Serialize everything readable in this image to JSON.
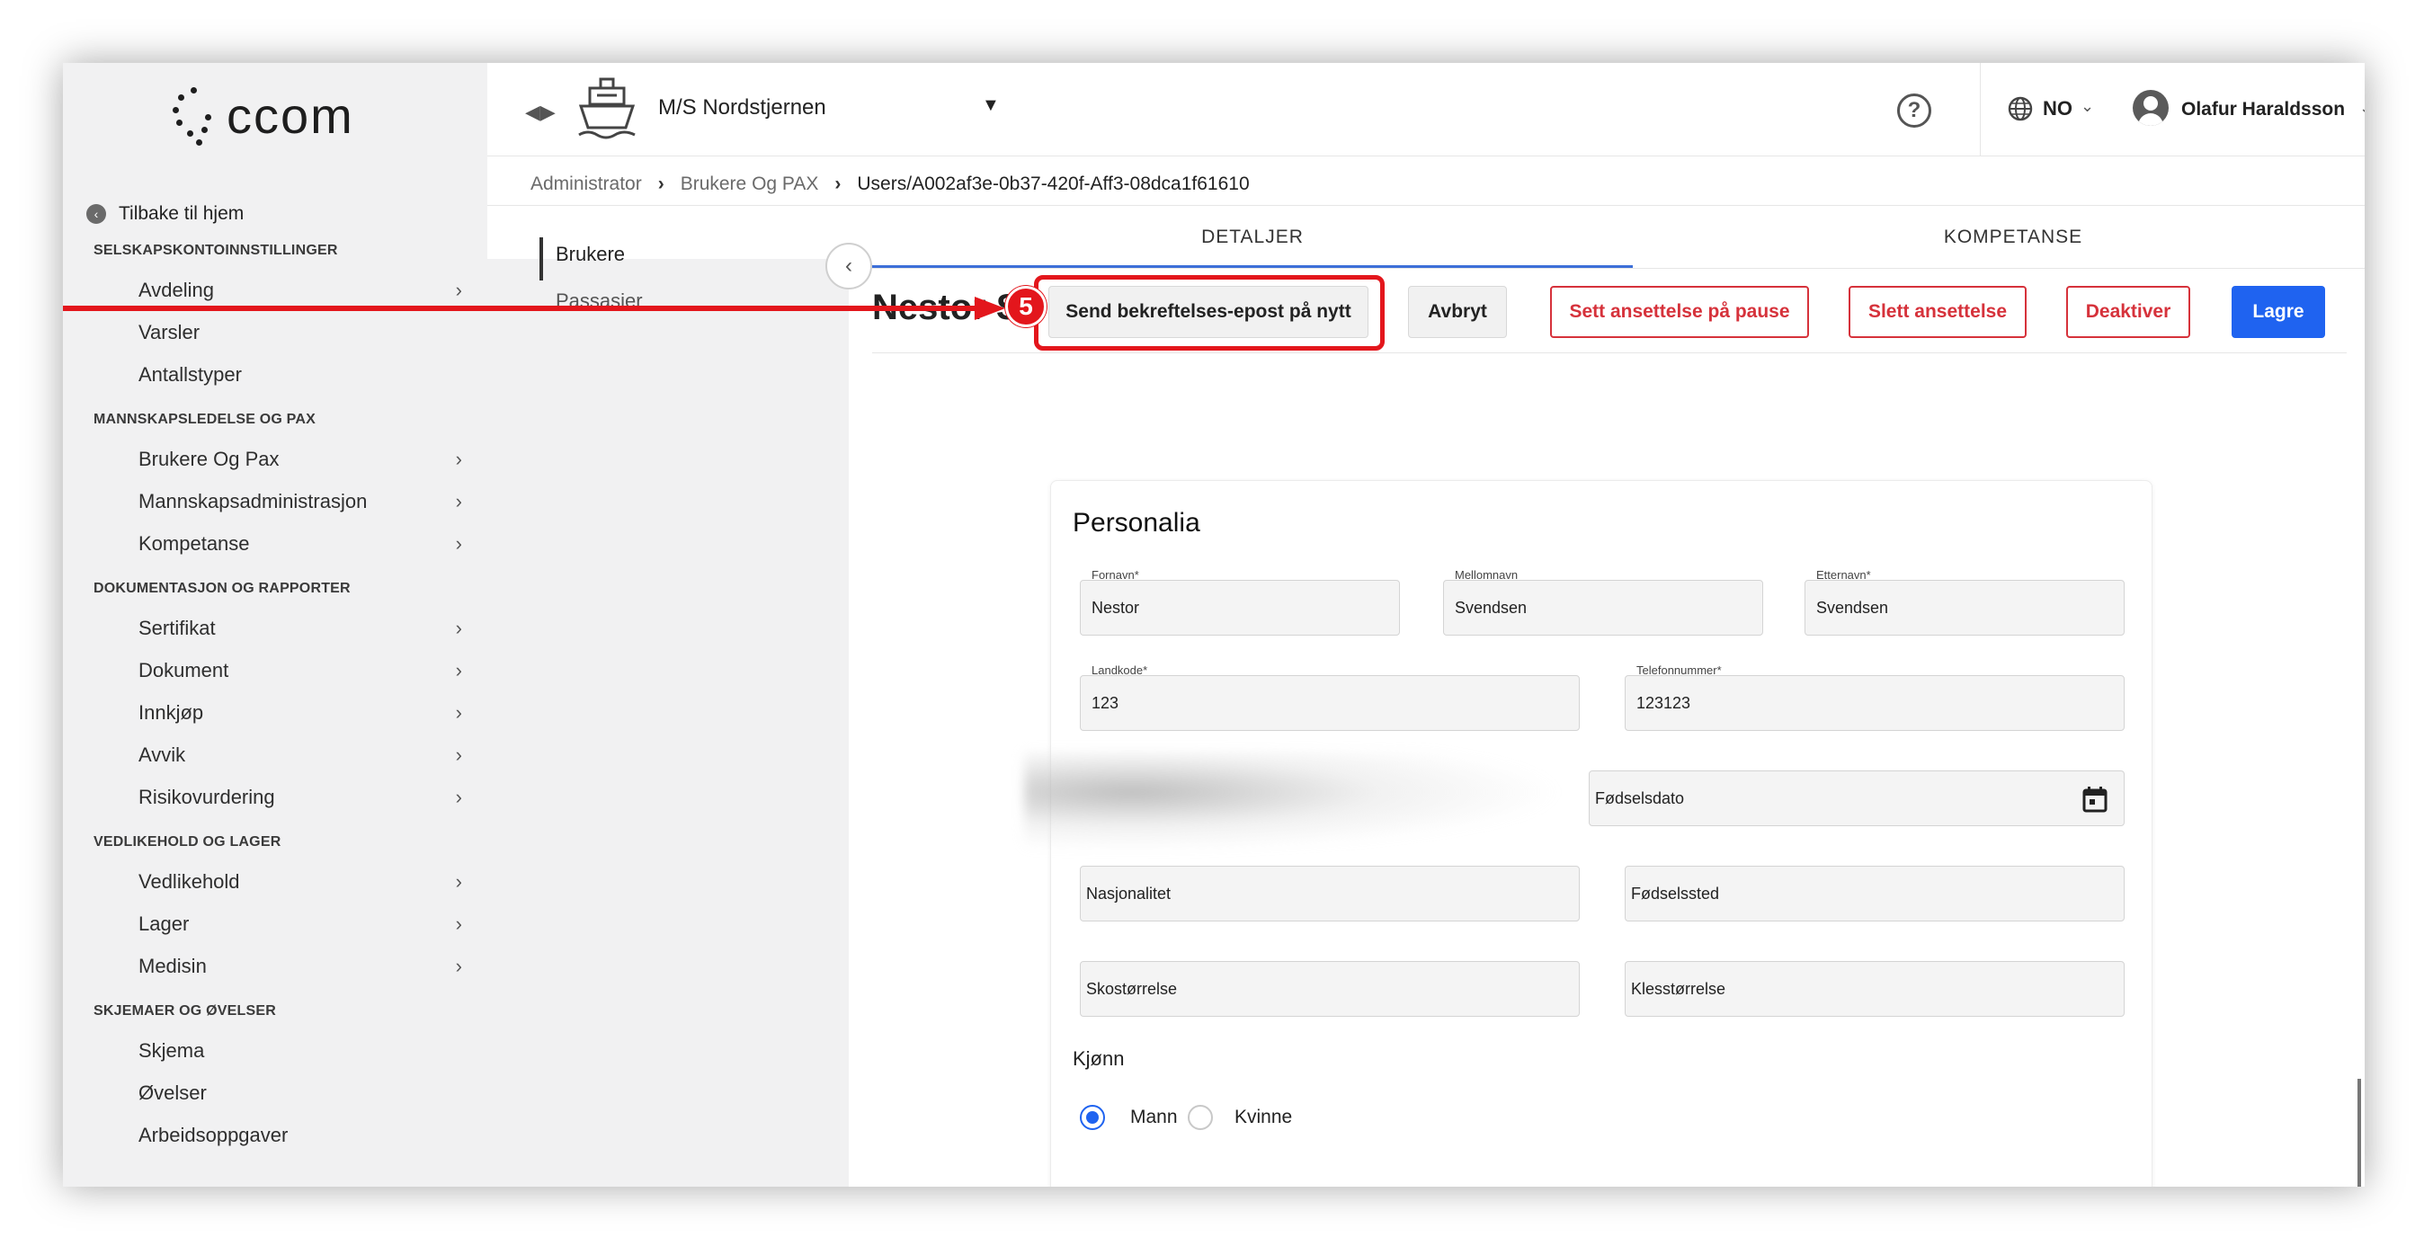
{
  "logo": {
    "text": "ccom"
  },
  "sidebar": {
    "back_label": "Tilbake til hjem",
    "sections": [
      {
        "title": "SELSKAPSKONTOINNSTILLINGER",
        "items": [
          {
            "label": "Avdeling",
            "chevron": true
          },
          {
            "label": "Varsler",
            "chevron": false
          },
          {
            "label": "Antallstyper",
            "chevron": false
          }
        ]
      },
      {
        "title": "MANNSKAPSLEDELSE OG PAX",
        "items": [
          {
            "label": "Brukere Og Pax",
            "chevron": true
          },
          {
            "label": "Mannskapsadministrasjon",
            "chevron": true
          },
          {
            "label": "Kompetanse",
            "chevron": true
          }
        ]
      },
      {
        "title": "DOKUMENTASJON OG RAPPORTER",
        "items": [
          {
            "label": "Sertifikat",
            "chevron": true
          },
          {
            "label": "Dokument",
            "chevron": true
          },
          {
            "label": "Innkjøp",
            "chevron": true
          },
          {
            "label": "Avvik",
            "chevron": true
          },
          {
            "label": "Risikovurdering",
            "chevron": true
          }
        ]
      },
      {
        "title": "VEDLIKEHOLD OG LAGER",
        "items": [
          {
            "label": "Vedlikehold",
            "chevron": true
          },
          {
            "label": "Lager",
            "chevron": true
          },
          {
            "label": "Medisin",
            "chevron": true
          }
        ]
      },
      {
        "title": "SKJEMAER OG ØVELSER",
        "items": [
          {
            "label": "Skjema",
            "chevron": false
          },
          {
            "label": "Øvelser",
            "chevron": false
          },
          {
            "label": "Arbeidsoppgaver",
            "chevron": false
          }
        ]
      }
    ]
  },
  "header": {
    "vessel_name": "M/S Nordstjernen",
    "language": "NO",
    "user_name": "Olafur Haraldsson"
  },
  "breadcrumb": {
    "items": [
      "Administrator",
      "Brukere Og PAX"
    ],
    "current": "Users/A002af3e-0b37-420f-Aff3-08dca1f61610"
  },
  "subnav": {
    "items": [
      "Brukere",
      "Passasjer"
    ]
  },
  "tabs": {
    "details": "DETALJER",
    "competence": "KOMPETANSE"
  },
  "page": {
    "title": "Nestor Svendsen"
  },
  "actions": {
    "resend": "Send bekreftelses-epost på nytt",
    "cancel": "Avbryt",
    "pause": "Sett ansettelse på pause",
    "delete": "Slett ansettelse",
    "deactivate": "Deaktiver",
    "save": "Lagre"
  },
  "annotation": {
    "step": "5",
    "color": "#e3161c"
  },
  "form": {
    "title": "Personalia",
    "first_name": {
      "label": "Fornavn*",
      "value": "Nestor"
    },
    "middle_name": {
      "label": "Mellomnavn",
      "value": "Svendsen"
    },
    "last_name": {
      "label": "Etternavn*",
      "value": "Svendsen"
    },
    "country_code": {
      "label": "Landkode*",
      "value": "123"
    },
    "phone": {
      "label": "Telefonnummer*",
      "value": "123123"
    },
    "birth_date": {
      "placeholder": "Fødselsdato"
    },
    "nationality": {
      "placeholder": "Nasjonalitet"
    },
    "birth_place": {
      "placeholder": "Fødselssted"
    },
    "shoe_size": {
      "placeholder": "Skostørrelse"
    },
    "clothing_size": {
      "placeholder": "Klesstørrelse"
    },
    "gender": {
      "label": "Kjønn",
      "options": [
        "Mann",
        "Kvinne"
      ],
      "selected": "Mann"
    }
  },
  "colors": {
    "primary": "#1f63f0",
    "danger": "#d6323b",
    "tab_underline": "#3d6fd8"
  }
}
